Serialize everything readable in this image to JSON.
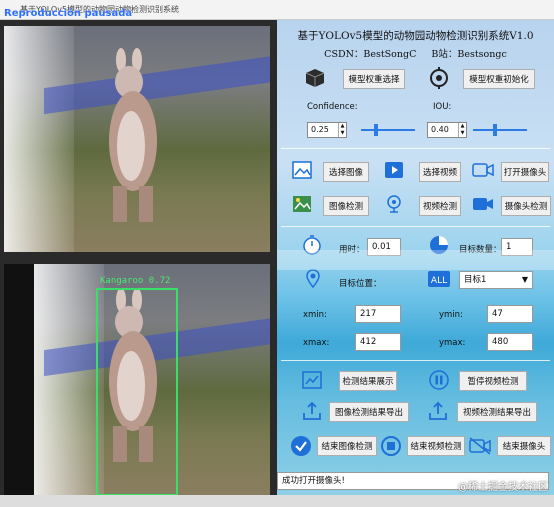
{
  "window": {
    "title": "基于YOLOv5模型的动物园动物检测识别系统",
    "overlay_text": "Reproducción pausada"
  },
  "detection": {
    "label": "Kangaroo  0.72"
  },
  "panel": {
    "title": "基于YOLOv5模型的动物园动物检测识别系统V1.0",
    "csdn": "CSDN：BestSongC",
    "bilibili": "B站：Bestsongc",
    "model_select": "模型权重选择",
    "model_init": "模型权重初始化",
    "confidence_label": "Confidence:",
    "iou_label": "IOU:",
    "confidence_value": "0.25",
    "iou_value": "0.40",
    "confidence_level": 0.25,
    "iou_level": 0.4,
    "select_image": "选择图像",
    "select_video": "选择视频",
    "open_camera": "打开摄像头",
    "image_detect": "图像检测",
    "video_detect": "视频检测",
    "camera_detect": "摄像头检测",
    "time_label": "用时：",
    "time_value": "0.01",
    "count_label": "目标数量：",
    "count_value": "1",
    "position_label": "目标位置：",
    "target_select": "目标1",
    "xmin_label": "xmin:",
    "xmin_value": "217",
    "ymin_label": "ymin:",
    "ymin_value": "47",
    "xmax_label": "xmax:",
    "xmax_value": "412",
    "ymax_label": "ymax:",
    "ymax_value": "480",
    "show_results": "检测结果展示",
    "pause_video": "暂停视频检测",
    "export_image": "图像检测结果导出",
    "export_video": "视频检测结果导出",
    "end_image": "结束图像检测",
    "end_video": "结束视频检测",
    "end_camera": "结束摄像头",
    "status": "成功打开摄像头!"
  },
  "watermark": "@稀土掘金技术社区",
  "colors": {
    "bbox": "#38e06a",
    "accent": "#2b7be3"
  }
}
